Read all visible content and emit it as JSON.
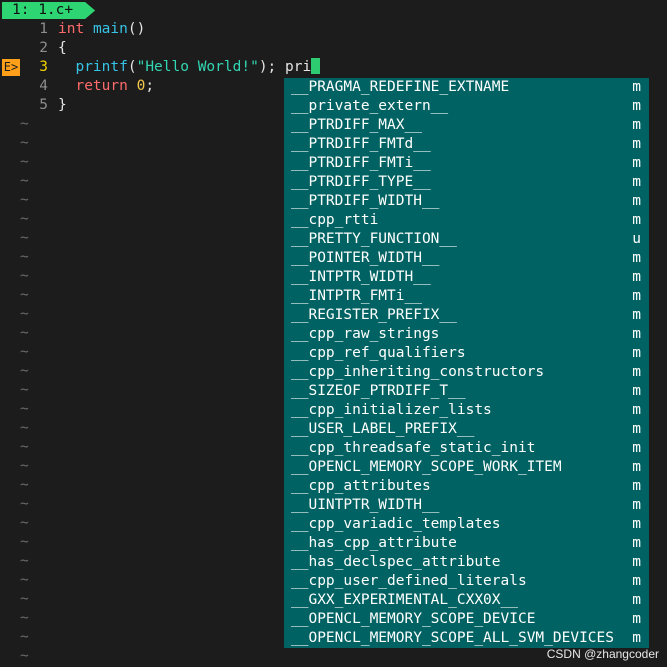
{
  "tab": {
    "label": "1: 1.c+"
  },
  "sign": {
    "label": "E>"
  },
  "lines": [
    {
      "num": "1",
      "tokens": [
        {
          "t": "kw",
          "v": "int"
        },
        {
          "t": "plain",
          "v": " "
        },
        {
          "t": "fn",
          "v": "main"
        },
        {
          "t": "plain",
          "v": "()"
        }
      ]
    },
    {
      "num": "2",
      "tokens": [
        {
          "t": "plain",
          "v": "{"
        }
      ]
    },
    {
      "num": "3",
      "tokens": [
        {
          "t": "plain",
          "v": "  "
        },
        {
          "t": "fn",
          "v": "printf"
        },
        {
          "t": "plain",
          "v": "("
        },
        {
          "t": "str",
          "v": "\"Hello World!\""
        },
        {
          "t": "plain",
          "v": "); pri"
        }
      ]
    },
    {
      "num": "4",
      "tokens": [
        {
          "t": "plain",
          "v": "  "
        },
        {
          "t": "kw",
          "v": "return"
        },
        {
          "t": "plain",
          "v": " "
        },
        {
          "t": "num",
          "v": "0"
        },
        {
          "t": "plain",
          "v": ";"
        }
      ]
    },
    {
      "num": "5",
      "tokens": [
        {
          "t": "plain",
          "v": "}"
        }
      ]
    }
  ],
  "tilde": "~",
  "completion": [
    {
      "word": "__PRAGMA_REDEFINE_EXTNAME",
      "kind": "m"
    },
    {
      "word": "__private_extern__",
      "kind": "m"
    },
    {
      "word": "__PTRDIFF_MAX__",
      "kind": "m"
    },
    {
      "word": "__PTRDIFF_FMTd__",
      "kind": "m"
    },
    {
      "word": "__PTRDIFF_FMTi__",
      "kind": "m"
    },
    {
      "word": "__PTRDIFF_TYPE__",
      "kind": "m"
    },
    {
      "word": "__PTRDIFF_WIDTH__",
      "kind": "m"
    },
    {
      "word": "__cpp_rtti",
      "kind": "m"
    },
    {
      "word": "__PRETTY_FUNCTION__",
      "kind": "u"
    },
    {
      "word": "__POINTER_WIDTH__",
      "kind": "m"
    },
    {
      "word": "__INTPTR_WIDTH__",
      "kind": "m"
    },
    {
      "word": "__INTPTR_FMTi__",
      "kind": "m"
    },
    {
      "word": "__REGISTER_PREFIX__",
      "kind": "m"
    },
    {
      "word": "__cpp_raw_strings",
      "kind": "m"
    },
    {
      "word": "__cpp_ref_qualifiers",
      "kind": "m"
    },
    {
      "word": "__cpp_inheriting_constructors",
      "kind": "m"
    },
    {
      "word": "__SIZEOF_PTRDIFF_T__",
      "kind": "m"
    },
    {
      "word": "__cpp_initializer_lists",
      "kind": "m"
    },
    {
      "word": "__USER_LABEL_PREFIX__",
      "kind": "m"
    },
    {
      "word": "__cpp_threadsafe_static_init",
      "kind": "m"
    },
    {
      "word": "__OPENCL_MEMORY_SCOPE_WORK_ITEM",
      "kind": "m"
    },
    {
      "word": "__cpp_attributes",
      "kind": "m"
    },
    {
      "word": "__UINTPTR_WIDTH__",
      "kind": "m"
    },
    {
      "word": "__cpp_variadic_templates",
      "kind": "m"
    },
    {
      "word": "__has_cpp_attribute",
      "kind": "m"
    },
    {
      "word": "__has_declspec_attribute",
      "kind": "m"
    },
    {
      "word": "__cpp_user_defined_literals",
      "kind": "m"
    },
    {
      "word": "__GXX_EXPERIMENTAL_CXX0X__",
      "kind": "m"
    },
    {
      "word": "__OPENCL_MEMORY_SCOPE_DEVICE",
      "kind": "m"
    },
    {
      "word": "__OPENCL_MEMORY_SCOPE_ALL_SVM_DEVICES",
      "kind": "m"
    }
  ],
  "watermark": "CSDN @zhangcoder",
  "colors": {
    "tab": "#2ed573",
    "popup": "#006262",
    "sign": "#ff9f1a",
    "cursor": "#2ecc71"
  }
}
